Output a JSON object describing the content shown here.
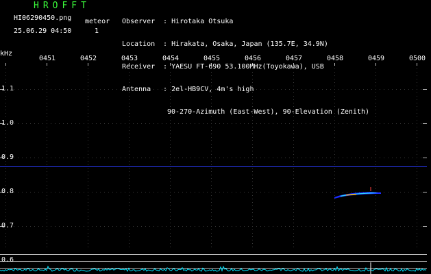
{
  "header": {
    "logo": "HROFFT",
    "filename": "HI06290450.png",
    "datetime": "25.06.29 04:50",
    "meteor_label": "meteor",
    "meteor_count": "1",
    "observer_key": "Observer",
    "observer_val": "Hirotaka Otsuka",
    "location_key": "Location",
    "location_val": "Hirakata, Osaka, Japan (135.7E, 34.9N)",
    "receiver_key": "Receiver",
    "receiver_val": "YAESU FT-690 53.100MHz(Toyokawa), USB",
    "antenna_key": "Antenna",
    "antenna_val": "2el-HB9CV, 4m's high",
    "antenna_val2": "90-270-Azimuth (East-West), 90-Elevation (Zenith)"
  },
  "axes": {
    "y_unit": "kHz",
    "y_ticks": [
      "1.1",
      "1.0",
      "0.9",
      "0.8",
      "0.7",
      "0.6"
    ],
    "x_ticks": [
      "0451",
      "0452",
      "0453",
      "0454",
      "0455",
      "0456",
      "0457",
      "0458",
      "0459",
      "0500"
    ]
  },
  "colors": {
    "background": "#000000",
    "logo": "#3cff3c",
    "text": "#ffffff",
    "carrier": "#2a3cff",
    "spectrum": "#00e5ff",
    "meteor_core": "#ffb000"
  }
}
